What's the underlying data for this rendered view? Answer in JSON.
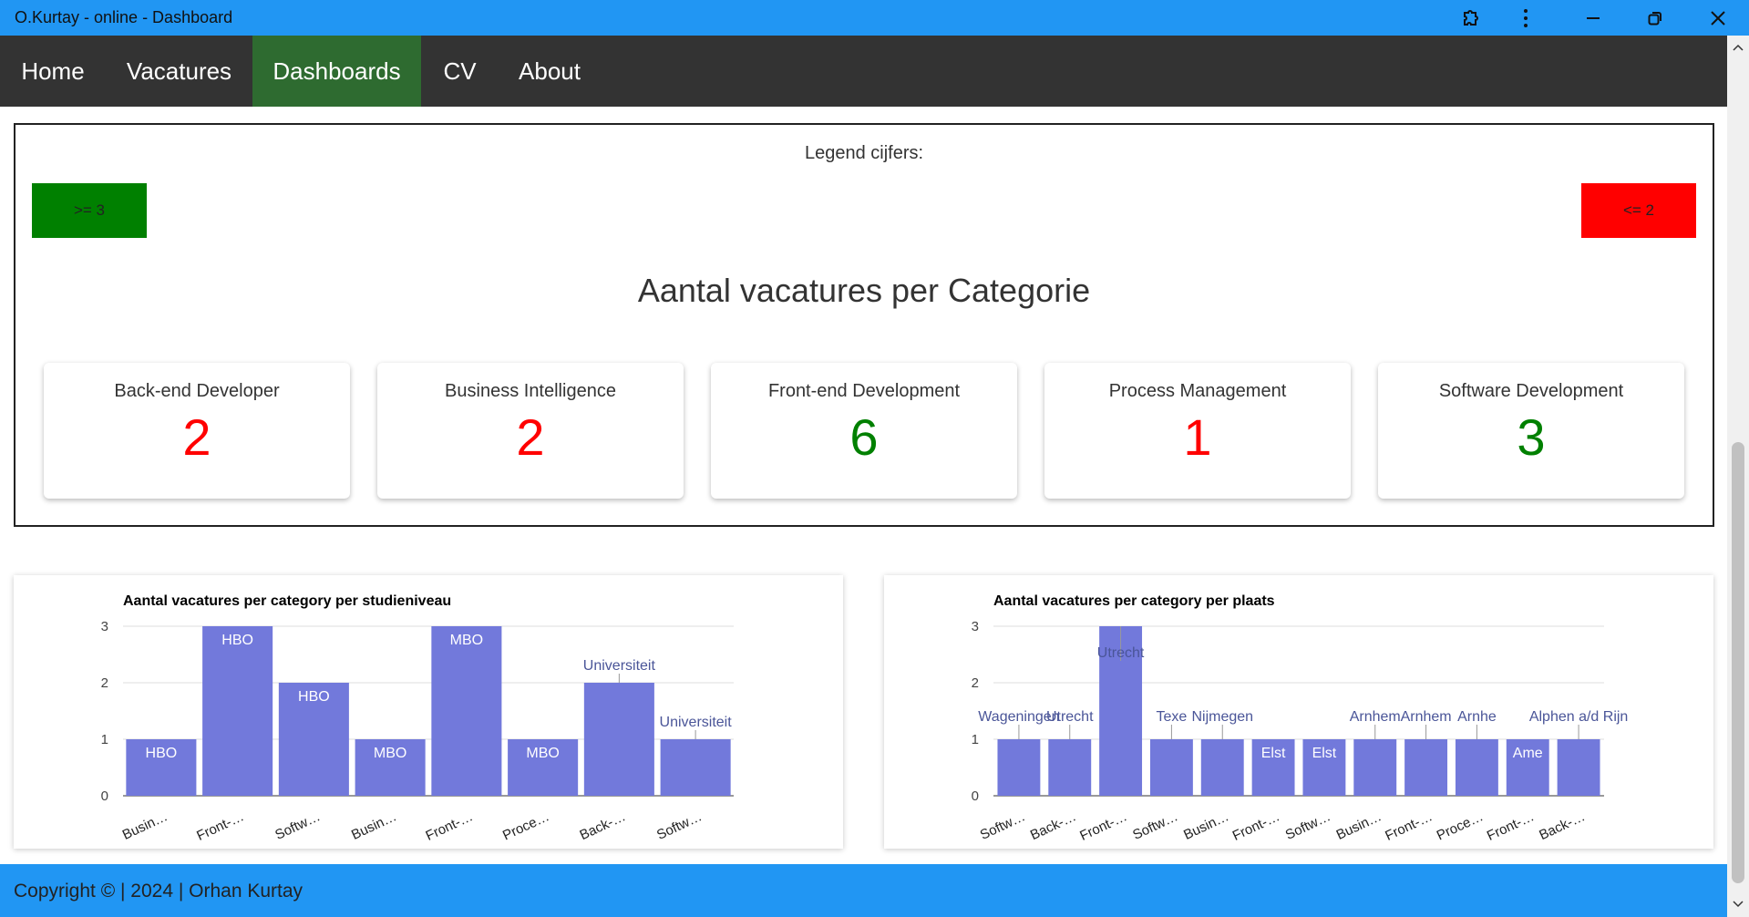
{
  "window": {
    "title": "O.Kurtay - online - Dashboard",
    "accent_color": "#2196f3",
    "controls": [
      "extension-icon",
      "more-icon",
      "minimize-icon",
      "restore-icon",
      "close-icon"
    ]
  },
  "nav": {
    "items": [
      {
        "label": "Home",
        "active": false
      },
      {
        "label": "Vacatures",
        "active": false
      },
      {
        "label": "Dashboards",
        "active": true
      },
      {
        "label": "CV",
        "active": false
      },
      {
        "label": "About",
        "active": false
      }
    ],
    "background": "#333333",
    "active_background": "#2e6b30"
  },
  "legend": {
    "title": "Legend cijfers:",
    "high": {
      "label": ">= 3",
      "color": "#008000"
    },
    "low": {
      "label": "<= 2",
      "color": "#ff0000"
    }
  },
  "section": {
    "title": "Aantal vacatures per Categorie",
    "cards": [
      {
        "name": "Back-end Developer",
        "value": 2
      },
      {
        "name": "Business Intelligence",
        "value": 2
      },
      {
        "name": "Front-end Development",
        "value": 6
      },
      {
        "name": "Process Management",
        "value": 1
      },
      {
        "name": "Software Development",
        "value": 3
      }
    ]
  },
  "chart_data": [
    {
      "type": "bar",
      "title": "Aantal vacatures per category per studieniveau",
      "categories": [
        "Busin…",
        "Front-…",
        "Softw…",
        "Busin…",
        "Front-…",
        "Proce…",
        "Back-…",
        "Softw…"
      ],
      "values": [
        1,
        3,
        2,
        1,
        3,
        1,
        2,
        1
      ],
      "annotations": [
        "HBO",
        "HBO",
        "HBO",
        "MBO",
        "MBO",
        "MBO",
        "Universiteit",
        "Universiteit"
      ],
      "yticks": [
        0,
        1,
        2,
        3
      ],
      "ylim": [
        0,
        3
      ],
      "bar_color": "#7279db",
      "grid": true
    },
    {
      "type": "bar",
      "title": "Aantal vacatures per category per plaats",
      "categories": [
        "Softw…",
        "Back-…",
        "Front-…",
        "Softw…",
        "Busin…",
        "Front-…",
        "Softw…",
        "Busin…",
        "Front-…",
        "Proce…",
        "Front-…",
        "Back-…"
      ],
      "values": [
        1,
        1,
        3,
        1,
        1,
        1,
        1,
        1,
        1,
        1,
        1,
        1
      ],
      "annotations": [
        "Wagening…",
        "Utrecht",
        "Utrecht",
        "Texel",
        "Nijmegen",
        "Elst",
        "Elst",
        "Arnhem",
        "Arnhem",
        "Arnhem",
        "Amersfoort",
        "Alphen a/d Rijn"
      ],
      "annotations_shown": [
        "Wageningen",
        "Utrecht",
        "Utrecht",
        "Texe",
        "Nijmegen",
        "Elst",
        "Elst",
        "Arnhem",
        "Arnhem",
        "Arnhe",
        "Ame",
        "Alphen a/d Rijn"
      ],
      "yticks": [
        0,
        1,
        2,
        3
      ],
      "ylim": [
        0,
        3
      ],
      "bar_color": "#7279db",
      "grid": true
    }
  ],
  "footer": {
    "text": "Copyright © | 2024 | Orhan Kurtay"
  }
}
